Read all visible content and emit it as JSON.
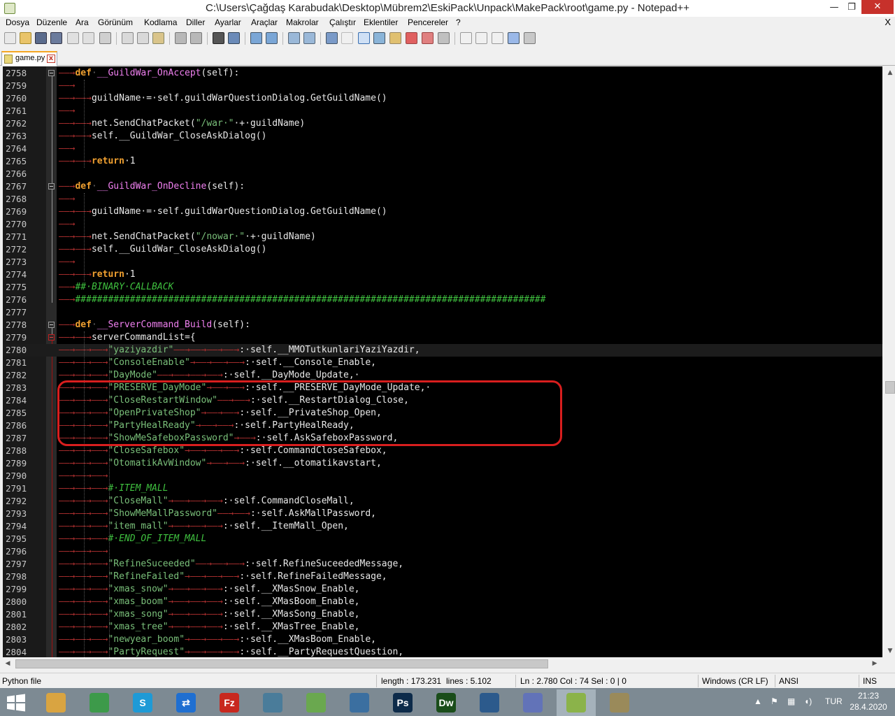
{
  "window": {
    "title": "C:\\Users\\Çağdaş Karabudak\\Desktop\\Mübrem2\\EskiPack\\Unpack\\MakePack\\root\\game.py - Notepad++",
    "min": "—",
    "max": "❐",
    "close": "✕"
  },
  "menu": {
    "items": [
      "Dosya",
      "Düzenle",
      "Ara",
      "Görünüm",
      "Kodlama",
      "Diller",
      "Ayarlar",
      "Araçlar",
      "Makrolar",
      "Çalıştır",
      "Eklentiler",
      "Pencereler",
      "?"
    ],
    "close": "X"
  },
  "tab": {
    "label": "game.py",
    "close": "x"
  },
  "editor": {
    "lines": [
      {
        "n": "2758"
      },
      {
        "n": "2759"
      },
      {
        "n": "2760"
      },
      {
        "n": "2761"
      },
      {
        "n": "2762"
      },
      {
        "n": "2763"
      },
      {
        "n": "2764"
      },
      {
        "n": "2765"
      },
      {
        "n": "2766"
      },
      {
        "n": "2767"
      },
      {
        "n": "2768"
      },
      {
        "n": "2769"
      },
      {
        "n": "2770"
      },
      {
        "n": "2771"
      },
      {
        "n": "2772"
      },
      {
        "n": "2773"
      },
      {
        "n": "2774"
      },
      {
        "n": "2775"
      },
      {
        "n": "2776"
      },
      {
        "n": "2777"
      },
      {
        "n": "2778"
      },
      {
        "n": "2779"
      },
      {
        "n": "2780"
      },
      {
        "n": "2781"
      },
      {
        "n": "2782"
      },
      {
        "n": "2783"
      },
      {
        "n": "2784"
      },
      {
        "n": "2785"
      },
      {
        "n": "2786"
      },
      {
        "n": "2787"
      },
      {
        "n": "2788"
      },
      {
        "n": "2789"
      },
      {
        "n": "2790"
      },
      {
        "n": "2791"
      },
      {
        "n": "2792"
      },
      {
        "n": "2793"
      },
      {
        "n": "2794"
      },
      {
        "n": "2795"
      },
      {
        "n": "2796"
      },
      {
        "n": "2797"
      },
      {
        "n": "2798"
      },
      {
        "n": "2799"
      },
      {
        "n": "2800"
      },
      {
        "n": "2801"
      },
      {
        "n": "2802"
      },
      {
        "n": "2803"
      },
      {
        "n": "2804"
      }
    ],
    "code": [
      [
        [
          "t",
          "——→"
        ],
        [
          "k",
          "def"
        ],
        [
          "d",
          "·"
        ],
        [
          "f",
          "__GuildWar_OnAccept"
        ],
        [
          "p",
          "(self):"
        ]
      ],
      [
        [
          "t",
          "——→"
        ]
      ],
      [
        [
          "t",
          "——→——→"
        ],
        [
          "p",
          "guildName·=·self.guildWarQuestionDialog.GetGuildName()"
        ]
      ],
      [
        [
          "t",
          "——→"
        ]
      ],
      [
        [
          "t",
          "——→——→"
        ],
        [
          "p",
          "net.SendChatPacket("
        ],
        [
          "s",
          "\"/war·\""
        ],
        [
          "p",
          "·+·guildName)"
        ]
      ],
      [
        [
          "t",
          "——→——→"
        ],
        [
          "p",
          "self.__GuildWar_CloseAskDialog()"
        ]
      ],
      [
        [
          "t",
          "——→"
        ]
      ],
      [
        [
          "t",
          "——→——→"
        ],
        [
          "k",
          "return"
        ],
        [
          "p",
          "·1"
        ]
      ],
      [],
      [
        [
          "t",
          "——→"
        ],
        [
          "k",
          "def"
        ],
        [
          "d",
          "·"
        ],
        [
          "f",
          "__GuildWar_OnDecline"
        ],
        [
          "p",
          "(self):"
        ]
      ],
      [
        [
          "t",
          "——→"
        ]
      ],
      [
        [
          "t",
          "——→——→"
        ],
        [
          "p",
          "guildName·=·self.guildWarQuestionDialog.GetGuildName()"
        ]
      ],
      [
        [
          "t",
          "——→"
        ]
      ],
      [
        [
          "t",
          "——→——→"
        ],
        [
          "p",
          "net.SendChatPacket("
        ],
        [
          "s",
          "\"/nowar·\""
        ],
        [
          "p",
          "·+·guildName)"
        ]
      ],
      [
        [
          "t",
          "——→——→"
        ],
        [
          "p",
          "self.__GuildWar_CloseAskDialog()"
        ]
      ],
      [
        [
          "t",
          "——→"
        ]
      ],
      [
        [
          "t",
          "——→——→"
        ],
        [
          "k",
          "return"
        ],
        [
          "p",
          "·1"
        ]
      ],
      [
        [
          "t",
          "——→"
        ],
        [
          "c",
          "##·BINARY·CALLBACK"
        ]
      ],
      [
        [
          "t",
          "——→"
        ],
        [
          "c",
          "######################################################################################"
        ]
      ],
      [],
      [
        [
          "t",
          "——→"
        ],
        [
          "k",
          "def"
        ],
        [
          "d",
          "·"
        ],
        [
          "f",
          "__ServerCommand_Build"
        ],
        [
          "p",
          "(self):"
        ]
      ],
      [
        [
          "t",
          "——→——→"
        ],
        [
          "p",
          "serverCommandList={"
        ]
      ],
      [
        [
          "t",
          "——→——→——→"
        ],
        [
          "s",
          "\"yaziyazdir\""
        ],
        [
          "t",
          "——→——→——→——→"
        ],
        [
          "p",
          ":·self.__MMOTutkunlariYaziYazdir,"
        ]
      ],
      [
        [
          "t",
          "——→——→——→"
        ],
        [
          "s",
          "\"ConsoleEnable\""
        ],
        [
          "t",
          "→——→——→——→"
        ],
        [
          "p",
          ":·self.__Console_Enable,"
        ]
      ],
      [
        [
          "t",
          "——→——→——→"
        ],
        [
          "s",
          "\"DayMode\""
        ],
        [
          "t",
          "——→——→——→——→"
        ],
        [
          "p",
          ":·self.__DayMode_Update,·"
        ]
      ],
      [
        [
          "t",
          "——→——→——→"
        ],
        [
          "s",
          "\"PRESERVE_DayMode\""
        ],
        [
          "t",
          "→——→——→"
        ],
        [
          "p",
          ":·self.__PRESERVE_DayMode_Update,·"
        ]
      ],
      [
        [
          "t",
          "——→——→——→"
        ],
        [
          "s",
          "\"CloseRestartWindow\""
        ],
        [
          "t",
          "——→——→"
        ],
        [
          "p",
          ":·self.__RestartDialog_Close,"
        ]
      ],
      [
        [
          "t",
          "——→——→——→"
        ],
        [
          "s",
          "\"OpenPrivateShop\""
        ],
        [
          "t",
          "→——→——→"
        ],
        [
          "p",
          ":·self.__PrivateShop_Open,"
        ]
      ],
      [
        [
          "t",
          "——→——→——→"
        ],
        [
          "s",
          "\"PartyHealReady\""
        ],
        [
          "t",
          "→——→——→"
        ],
        [
          "p",
          ":·self.PartyHealReady,"
        ]
      ],
      [
        [
          "t",
          "——→——→——→"
        ],
        [
          "s",
          "\"ShowMeSafeboxPassword\""
        ],
        [
          "t",
          "→——→"
        ],
        [
          "p",
          ":·self.AskSafeboxPassword,"
        ]
      ],
      [
        [
          "t",
          "——→——→——→"
        ],
        [
          "s",
          "\"CloseSafebox\""
        ],
        [
          "t",
          "→——→——→——→"
        ],
        [
          "p",
          ":·self.CommandCloseSafebox,"
        ]
      ],
      [
        [
          "t",
          "——→——→——→"
        ],
        [
          "s",
          "\"OtomatikAvWindow\""
        ],
        [
          "t",
          "→——→——→"
        ],
        [
          "p",
          ":·self.__otomatikavstart,"
        ]
      ],
      [
        [
          "t",
          "——→——→——→"
        ]
      ],
      [
        [
          "t",
          "——→——→——→"
        ],
        [
          "c",
          "#·ITEM_MALL"
        ]
      ],
      [
        [
          "t",
          "——→——→——→"
        ],
        [
          "s",
          "\"CloseMall\""
        ],
        [
          "t",
          "→——→——→——→"
        ],
        [
          "p",
          ":·self.CommandCloseMall,"
        ]
      ],
      [
        [
          "t",
          "——→——→——→"
        ],
        [
          "s",
          "\"ShowMeMallPassword\""
        ],
        [
          "t",
          "——→——→"
        ],
        [
          "p",
          ":·self.AskMallPassword,"
        ]
      ],
      [
        [
          "t",
          "——→——→——→"
        ],
        [
          "s",
          "\"item_mall\""
        ],
        [
          "t",
          "→——→——→——→"
        ],
        [
          "p",
          ":·self.__ItemMall_Open,"
        ]
      ],
      [
        [
          "t",
          "——→——→——→"
        ],
        [
          "c",
          "#·END_OF_ITEM_MALL"
        ]
      ],
      [
        [
          "t",
          "——→——→——→"
        ]
      ],
      [
        [
          "t",
          "——→——→——→"
        ],
        [
          "s",
          "\"RefineSuceeded\""
        ],
        [
          "t",
          "——→——→——→"
        ],
        [
          "p",
          ":·self.RefineSuceededMessage,"
        ]
      ],
      [
        [
          "t",
          "——→——→——→"
        ],
        [
          "s",
          "\"RefineFailed\""
        ],
        [
          "t",
          "→——→——→——→"
        ],
        [
          "p",
          ":·self.RefineFailedMessage,"
        ]
      ],
      [
        [
          "t",
          "——→——→——→"
        ],
        [
          "s",
          "\"xmas_snow\""
        ],
        [
          "t",
          "→——→——→——→"
        ],
        [
          "p",
          ":·self.__XMasSnow_Enable,"
        ]
      ],
      [
        [
          "t",
          "——→——→——→"
        ],
        [
          "s",
          "\"xmas_boom\""
        ],
        [
          "t",
          "→——→——→——→"
        ],
        [
          "p",
          ":·self.__XMasBoom_Enable,"
        ]
      ],
      [
        [
          "t",
          "——→——→——→"
        ],
        [
          "s",
          "\"xmas_song\""
        ],
        [
          "t",
          "→——→——→——→"
        ],
        [
          "p",
          ":·self.__XMasSong_Enable,"
        ]
      ],
      [
        [
          "t",
          "——→——→——→"
        ],
        [
          "s",
          "\"xmas_tree\""
        ],
        [
          "t",
          "→——→——→——→"
        ],
        [
          "p",
          ":·self.__XMasTree_Enable,"
        ]
      ],
      [
        [
          "t",
          "——→——→——→"
        ],
        [
          "s",
          "\"newyear_boom\""
        ],
        [
          "t",
          "→——→——→——→"
        ],
        [
          "p",
          ":·self.__XMasBoom_Enable,"
        ]
      ],
      [
        [
          "t",
          "——→——→——→"
        ],
        [
          "s",
          "\"PartyRequest\""
        ],
        [
          "t",
          "→——→——→——→"
        ],
        [
          "p",
          ":·self.__PartyRequestQuestion,"
        ]
      ]
    ],
    "current_line_index": 22
  },
  "status": {
    "filetype": "Python file",
    "length": "length : 173.231",
    "lines": "lines : 5.102",
    "position": "Ln : 2.780    Col : 74    Sel : 0 | 0",
    "eol": "Windows (CR LF)",
    "encoding": "ANSI",
    "mode": "INS"
  },
  "taskbar": {
    "apps": [
      {
        "name": "explorer",
        "label": "",
        "color": "#d9a441"
      },
      {
        "name": "chrome",
        "label": "",
        "color": "#3d9a4a"
      },
      {
        "name": "skype",
        "label": "S",
        "color": "#1e9ad6"
      },
      {
        "name": "teamviewer",
        "label": "⇄",
        "color": "#1f6fd1"
      },
      {
        "name": "filezilla",
        "label": "Fz",
        "color": "#c8281e"
      },
      {
        "name": "network-tool",
        "label": "",
        "color": "#4a7c9a"
      },
      {
        "name": "sync-tool",
        "label": "",
        "color": "#6aa84f"
      },
      {
        "name": "python",
        "label": "",
        "color": "#3b6fa0"
      },
      {
        "name": "photoshop",
        "label": "Ps",
        "color": "#0d2b4a"
      },
      {
        "name": "dreamweaver",
        "label": "Dw",
        "color": "#1a4d1a"
      },
      {
        "name": "virtualbox",
        "label": "",
        "color": "#2c5a8c"
      },
      {
        "name": "discord",
        "label": "",
        "color": "#6273b8"
      },
      {
        "name": "notepadpp",
        "label": "",
        "color": "#8bb34a"
      },
      {
        "name": "paint",
        "label": "",
        "color": "#9a8a5a"
      }
    ],
    "language": "TUR",
    "time": "21:23",
    "date": "28.4.2020"
  },
  "colors": {
    "highlight_box": "#d81e1e",
    "taskbar": "#7d8a93"
  }
}
